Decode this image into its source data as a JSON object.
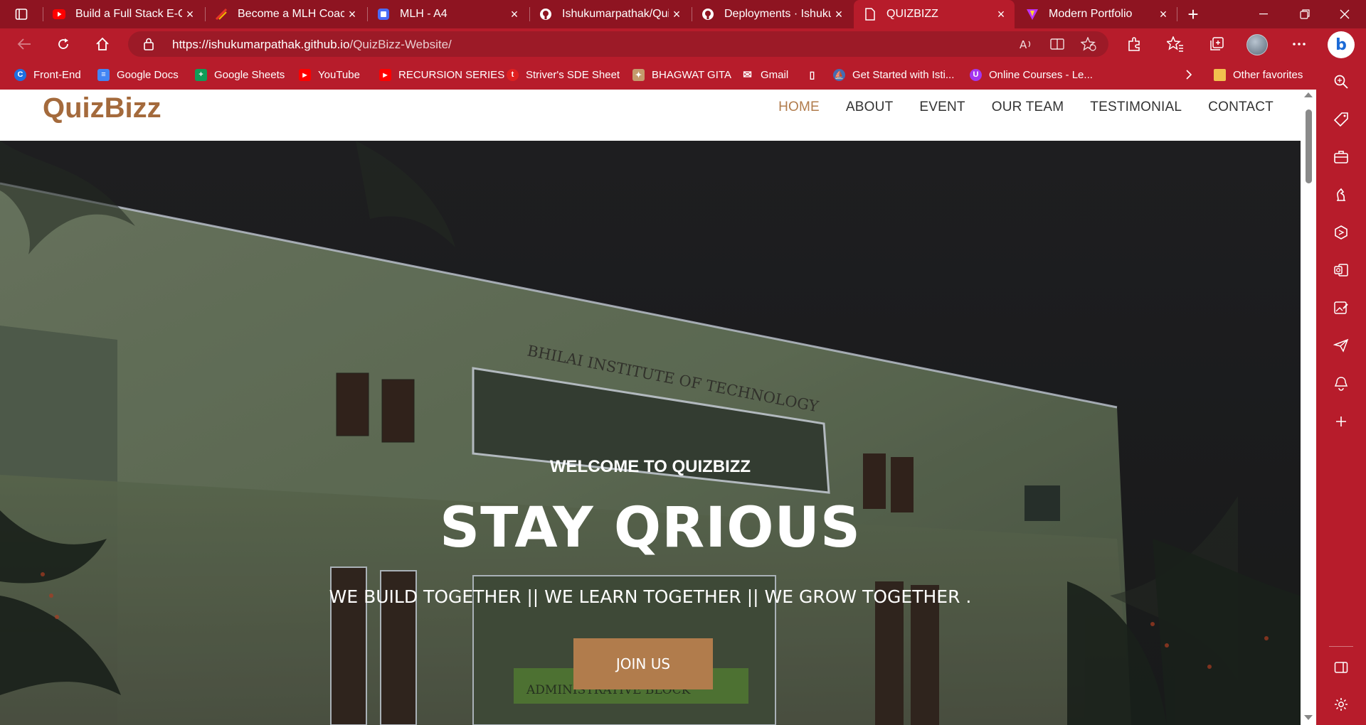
{
  "browser": {
    "tabs": [
      {
        "label": "Build a Full Stack E-Co",
        "icon": "youtube-icon",
        "color": "#ff0000"
      },
      {
        "label": "Become a MLH Coach",
        "icon": "mlh-icon",
        "color": "#e73427"
      },
      {
        "label": "MLH - A4",
        "icon": "document-icon",
        "color": "#4a6cf7"
      },
      {
        "label": "Ishukumarpathak/Qui",
        "icon": "github-icon",
        "color": "#ffffff"
      },
      {
        "label": "Deployments · Ishukur",
        "icon": "github-icon",
        "color": "#ffffff"
      },
      {
        "label": "QUIZBIZZ",
        "icon": "page-icon",
        "color": "#ffffff"
      },
      {
        "label": "Modern Portfolio",
        "icon": "vite-icon",
        "color": "#bd34fe"
      }
    ],
    "active_tab": "QUIZBIZZ",
    "new_tab_label": "+",
    "url_host": "https://ishukumarpathak.github.io",
    "url_path": "/QuizBizz-Website/",
    "favorites": [
      {
        "label": "Front-End",
        "icon": "c-icon",
        "color": "#1e6fe0",
        "glyph": "C"
      },
      {
        "label": "Google Docs",
        "icon": "google-docs-icon",
        "color": "#4285f4",
        "glyph": "≡"
      },
      {
        "label": "Google Sheets",
        "icon": "google-sheets-icon",
        "color": "#0f9d58",
        "glyph": "+"
      },
      {
        "label": "YouTube",
        "icon": "youtube-icon",
        "color": "#ff0000",
        "glyph": "▶"
      },
      {
        "label": "RECURSION SERIES",
        "icon": "youtube-icon",
        "color": "#ff0000",
        "glyph": "▶"
      },
      {
        "label": "Striver's SDE Sheet",
        "icon": "tuf-icon",
        "color": "#e02020",
        "glyph": "t"
      },
      {
        "label": "BHAGWAT GITA",
        "icon": "gita-icon",
        "color": "#c49a6c",
        "glyph": "✦"
      },
      {
        "label": "Gmail",
        "icon": "gmail-icon",
        "color": "#ffffff",
        "glyph": "✉"
      },
      {
        "label": "",
        "icon": "page-icon",
        "color": "#ffffff",
        "glyph": "▯"
      },
      {
        "label": "Get Started with Isti...",
        "icon": "istio-icon",
        "color": "#466bb0",
        "glyph": "⛵"
      },
      {
        "label": "Online Courses - Le...",
        "icon": "udemy-icon",
        "color": "#a435f0",
        "glyph": "U"
      }
    ],
    "other_favorites": "Other favorites"
  },
  "site": {
    "logo": "QuizBizz",
    "nav": [
      "HOME",
      "ABOUT",
      "EVENT",
      "OUR TEAM",
      "TESTIMONIAL",
      "CONTACT"
    ],
    "active_nav": "HOME",
    "hero": {
      "welcome": "WELCOME TO QUIZBIZZ",
      "headline": "STAY QRIOUS",
      "tagline": "WE BUILD TOGETHER || WE LEARN TOGETHER || WE GROW TOGETHER .",
      "cta": "JOIN US",
      "building_sign": "BHILAI INSTITUTE OF TECHNOLOGY",
      "block_sign": "ADMINISTRATIVE BLOCK"
    }
  },
  "colors": {
    "browser_accent": "#b71c2b",
    "brand": "#a46a3c",
    "cta": "#b17c4c"
  }
}
